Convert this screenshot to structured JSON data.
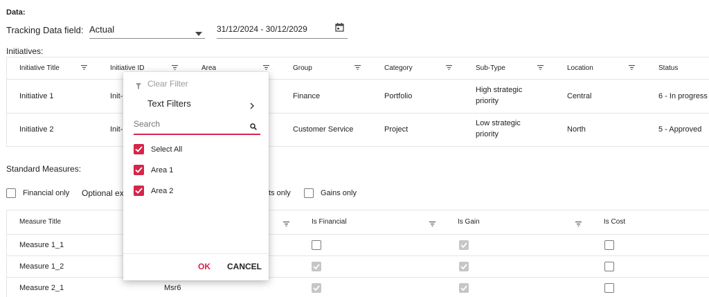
{
  "data_section": {
    "title": "Data:",
    "tracking_label": "Tracking Data field:",
    "tracking_value": "Actual",
    "date_range": "31/12/2024 - 30/12/2029"
  },
  "initiatives": {
    "title": "Initiatives:",
    "columns": [
      "Initiative Title",
      "Initiative ID",
      "Area",
      "Group",
      "Category",
      "Sub-Type",
      "Location",
      "Status"
    ],
    "rows": [
      {
        "title": "Initiative 1",
        "id": "Init-",
        "group": "Finance",
        "category": "Portfolio",
        "subtype_l1": "High strategic",
        "subtype_l2": "priority",
        "location": "Central",
        "status": "6 - In progress"
      },
      {
        "title": "Initiative 2",
        "id": "Init-",
        "group": "Customer Service",
        "category": "Project",
        "subtype_l1": "Low strategic",
        "subtype_l2": "priority",
        "location": "North",
        "status": "5 - Approved"
      }
    ]
  },
  "measures": {
    "title": "Standard Measures:",
    "filters": {
      "financial_only": "Financial only",
      "optional_partial": "Optional ex",
      "costs_partial": "ts only",
      "gains_only": "Gains only"
    },
    "columns": [
      "Measure Title",
      "Is Financial",
      "Is Gain",
      "Is Cost"
    ],
    "rows": [
      {
        "title": "Measure 1_1",
        "id": ""
      },
      {
        "title": "Measure 1_2",
        "id": ""
      },
      {
        "title": "Measure 2_1",
        "id": "Msr6"
      }
    ]
  },
  "filter_popup": {
    "clear_filter": "Clear Filter",
    "text_filters": "Text Filters",
    "search_placeholder": "Search",
    "options": [
      "Select All",
      "Area 1",
      "Area 2"
    ],
    "ok": "OK",
    "cancel": "CANCEL"
  },
  "colors": {
    "accent": "#d6244a",
    "disabled_check": "#c6c6c6"
  }
}
